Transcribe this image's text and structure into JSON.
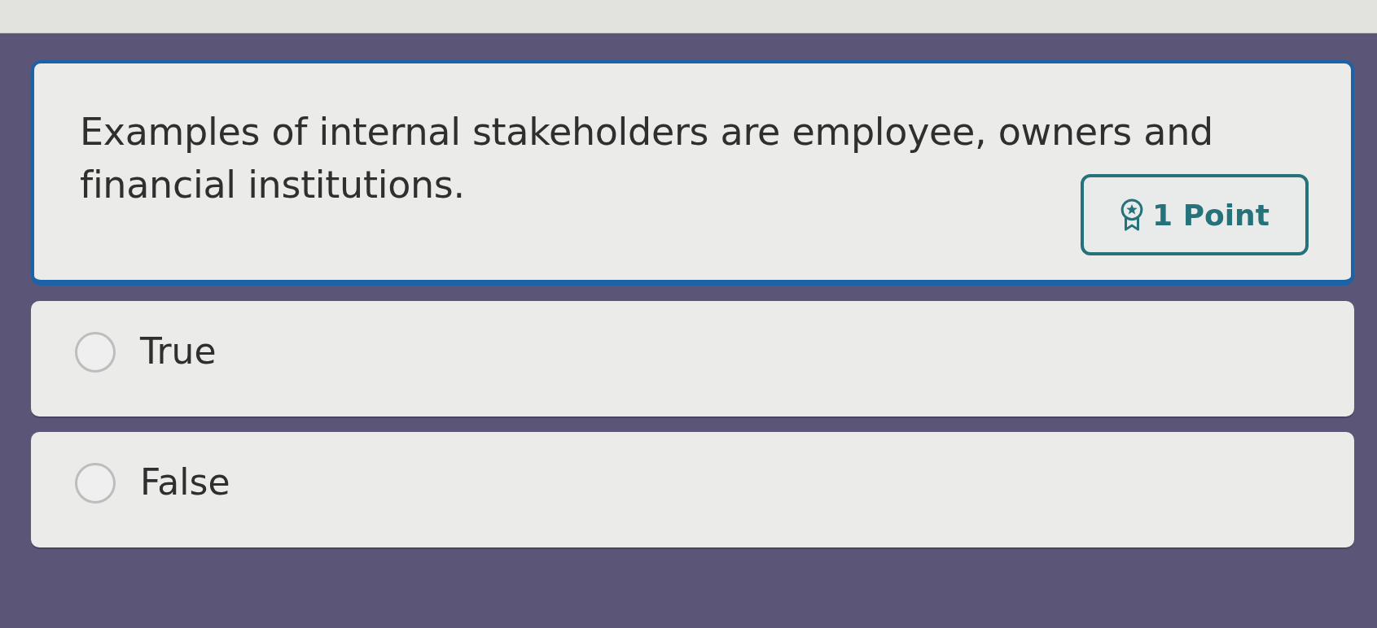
{
  "question": {
    "text": "Examples of internal stakeholders are employee, owners and financial institutions.",
    "points": "1 Point"
  },
  "options": [
    {
      "label": "True",
      "selected": false
    },
    {
      "label": "False",
      "selected": false
    }
  ]
}
